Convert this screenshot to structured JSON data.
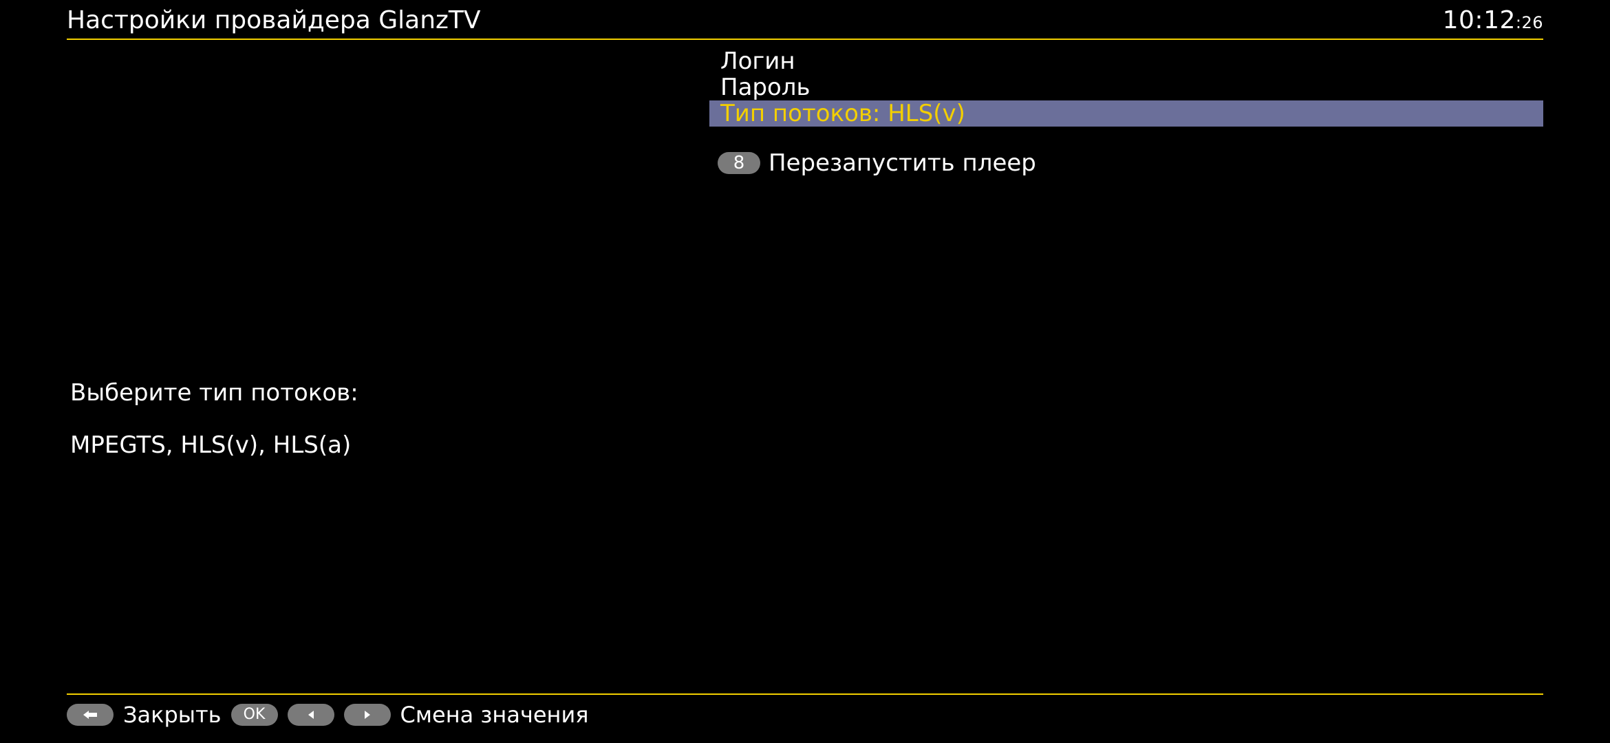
{
  "header": {
    "title": "Настройки провайдера GlanzTV",
    "clock_main": "10:12",
    "clock_seconds": ":26"
  },
  "menu": {
    "items": [
      {
        "label": "Логин",
        "selected": false
      },
      {
        "label": "Пароль",
        "selected": false
      },
      {
        "label_prefix": "Тип потоков: ",
        "value": "HLS(v)",
        "selected": true
      }
    ],
    "action": {
      "badge": "8",
      "label": "Перезапустить плеер"
    }
  },
  "hint": {
    "line1": "Выберите тип потоков:",
    "line2": "MPEGTS, HLS(v), HLS(a)"
  },
  "footer": {
    "close_label": "Закрыть",
    "ok_label": "OK",
    "change_label": "Смена значения"
  },
  "colors": {
    "accent": "#f3cf00",
    "highlight_bg": "#6b6f9a",
    "pill_bg": "#7a7a7a"
  }
}
